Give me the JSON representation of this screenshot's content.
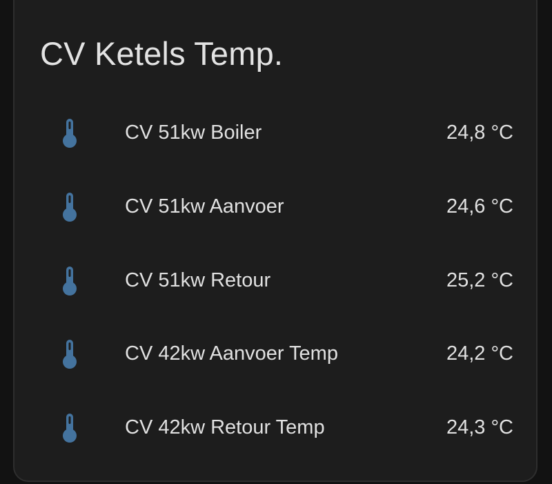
{
  "card": {
    "title": "CV Ketels Temp."
  },
  "colors": {
    "icon": "#44739e",
    "text": "#e1e1e1",
    "card_background": "#1d1d1d"
  },
  "entities": [
    {
      "icon": "thermometer-icon",
      "name": "CV 51kw Boiler",
      "state": "24,8 °C"
    },
    {
      "icon": "thermometer-icon",
      "name": "CV 51kw Aanvoer",
      "state": "24,6 °C"
    },
    {
      "icon": "thermometer-icon",
      "name": "CV 51kw Retour",
      "state": "25,2 °C"
    },
    {
      "icon": "thermometer-icon",
      "name": "CV 42kw Aanvoer Temp",
      "state": "24,2 °C"
    },
    {
      "icon": "thermometer-icon",
      "name": "CV 42kw Retour Temp",
      "state": "24,3 °C"
    }
  ]
}
